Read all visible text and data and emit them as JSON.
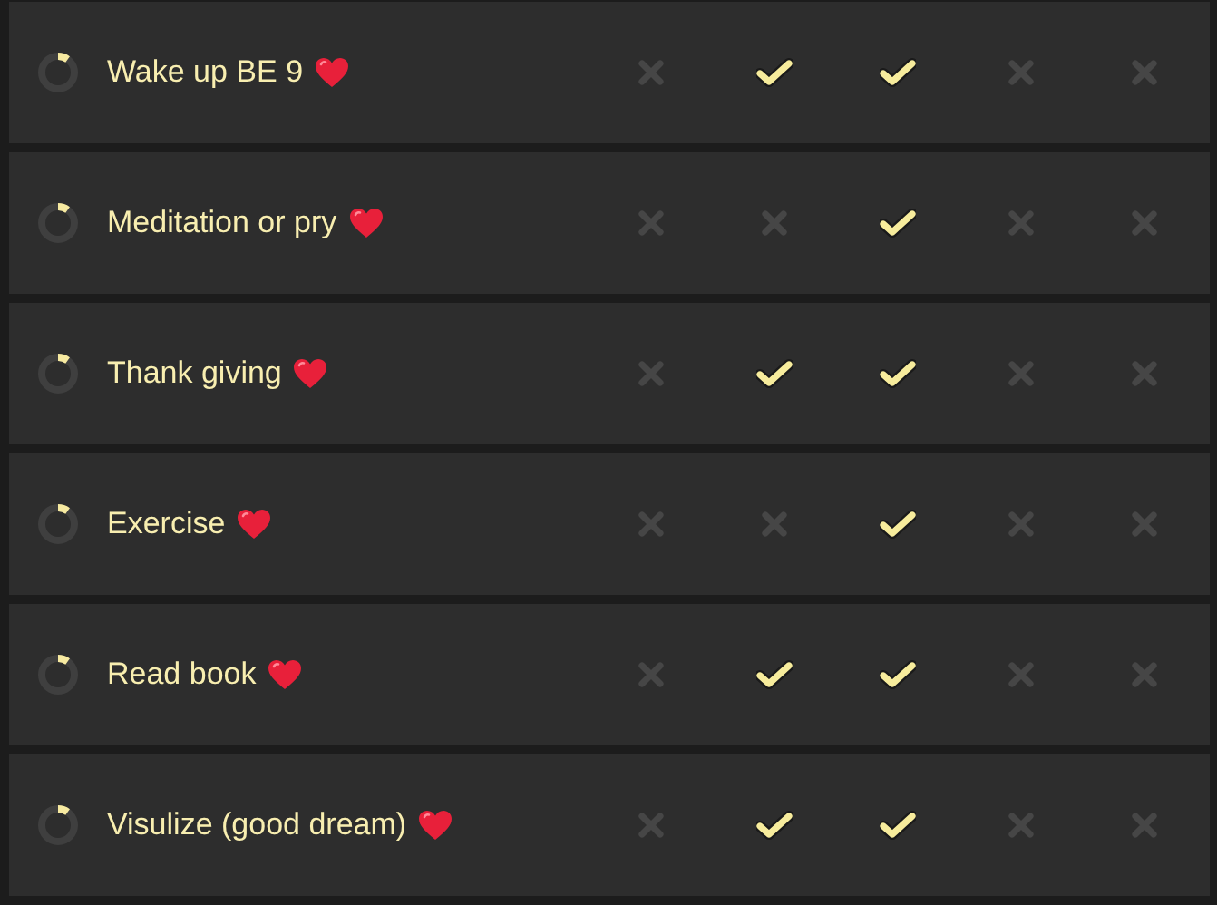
{
  "habits": [
    {
      "name": "Wake up BE 9",
      "days": [
        {
          "done": false
        },
        {
          "done": true
        },
        {
          "done": true
        },
        {
          "done": false
        },
        {
          "done": false
        }
      ]
    },
    {
      "name": "Meditation or pry",
      "days": [
        {
          "done": false
        },
        {
          "done": false
        },
        {
          "done": true
        },
        {
          "done": false
        },
        {
          "done": false
        }
      ]
    },
    {
      "name": "Thank giving",
      "days": [
        {
          "done": false
        },
        {
          "done": true
        },
        {
          "done": true
        },
        {
          "done": false
        },
        {
          "done": false
        }
      ]
    },
    {
      "name": "Exercise",
      "days": [
        {
          "done": false
        },
        {
          "done": false
        },
        {
          "done": true
        },
        {
          "done": false
        },
        {
          "done": false
        }
      ]
    },
    {
      "name": "Read book",
      "days": [
        {
          "done": false
        },
        {
          "done": true
        },
        {
          "done": true
        },
        {
          "done": false
        },
        {
          "done": false
        }
      ]
    },
    {
      "name": "Visulize (good dream)",
      "days": [
        {
          "done": false
        },
        {
          "done": true
        },
        {
          "done": true
        },
        {
          "done": false
        },
        {
          "done": false
        }
      ]
    }
  ]
}
